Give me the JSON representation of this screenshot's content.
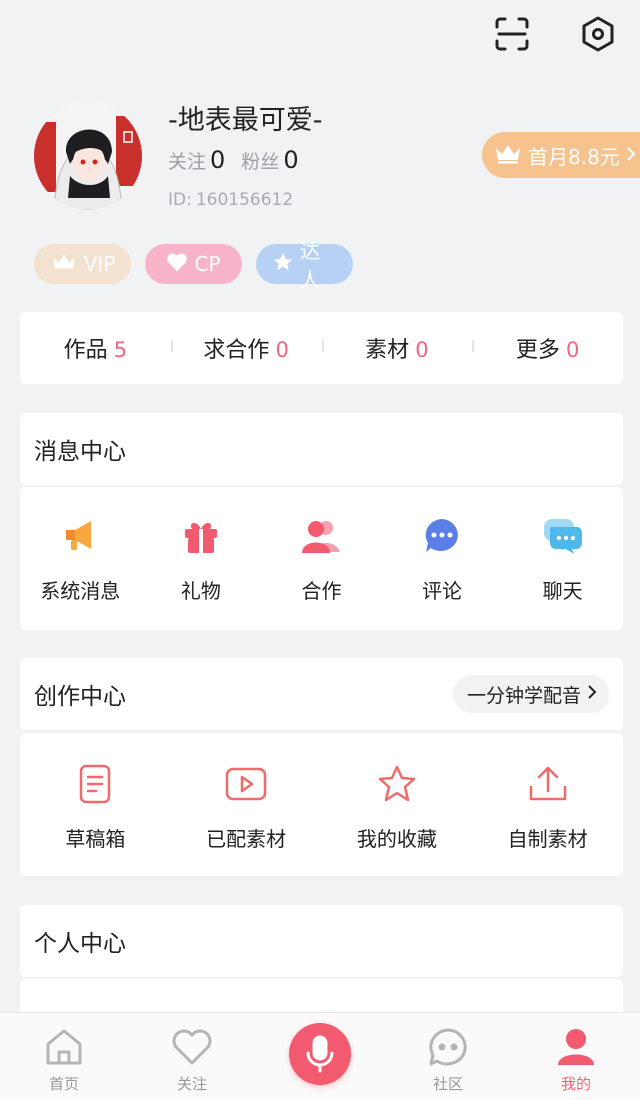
{
  "top_bar": {
    "scan_icon": "scan-icon",
    "settings_icon": "hexagon-settings-icon"
  },
  "profile": {
    "username": "-地表最可爱-",
    "following_label": "关注",
    "following_count": "0",
    "fans_label": "粉丝",
    "fans_count": "0",
    "id_label": "ID:",
    "id_value": "160156612",
    "vip_promo": "首月8.8元"
  },
  "badges": [
    {
      "label": "VIP",
      "icon": "crown-icon"
    },
    {
      "label": "CP",
      "icon": "heart-icon"
    },
    {
      "label": "达人",
      "icon": "star-icon"
    }
  ],
  "works": [
    {
      "label": "作品",
      "count": "5"
    },
    {
      "label": "求合作",
      "count": "0"
    },
    {
      "label": "素材",
      "count": "0"
    },
    {
      "label": "更多",
      "count": "0"
    }
  ],
  "message_center": {
    "title": "消息中心",
    "items": [
      {
        "label": "系统消息",
        "icon": "megaphone-icon"
      },
      {
        "label": "礼物",
        "icon": "gift-icon"
      },
      {
        "label": "合作",
        "icon": "people-icon"
      },
      {
        "label": "评论",
        "icon": "comment-bubble-icon"
      },
      {
        "label": "聊天",
        "icon": "chat-icon"
      }
    ]
  },
  "creation_center": {
    "title": "创作中心",
    "learn_label": "一分钟学配音",
    "items": [
      {
        "label": "草稿箱",
        "icon": "draft-icon"
      },
      {
        "label": "已配素材",
        "icon": "play-video-icon"
      },
      {
        "label": "我的收藏",
        "icon": "star-outline-icon"
      },
      {
        "label": "自制素材",
        "icon": "upload-icon"
      }
    ]
  },
  "personal_center": {
    "title": "个人中心"
  },
  "tabbar": [
    {
      "label": "首页",
      "icon": "home-icon",
      "active": false
    },
    {
      "label": "关注",
      "icon": "heart-outline-icon",
      "active": false
    },
    {
      "label": "",
      "icon": "microphone-icon",
      "active": false
    },
    {
      "label": "社区",
      "icon": "community-chat-icon",
      "active": false
    },
    {
      "label": "我的",
      "icon": "user-icon",
      "active": true
    }
  ],
  "colors": {
    "accent": "#f4657c",
    "vip_gold": "#f6c38f",
    "background": "#f1f2f4"
  }
}
